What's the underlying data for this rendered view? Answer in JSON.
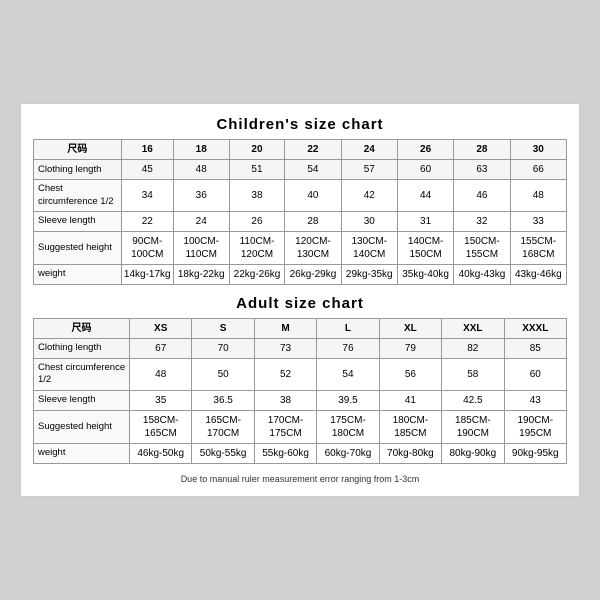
{
  "children_chart": {
    "title": "Children's size chart",
    "columns": [
      "尺码",
      "16",
      "18",
      "20",
      "22",
      "24",
      "26",
      "28",
      "30"
    ],
    "rows": [
      {
        "label": "Clothing length",
        "values": [
          "45",
          "48",
          "51",
          "54",
          "57",
          "60",
          "63",
          "66"
        ]
      },
      {
        "label": "Chest circumference 1/2",
        "values": [
          "34",
          "36",
          "38",
          "40",
          "42",
          "44",
          "46",
          "48"
        ]
      },
      {
        "label": "Sleeve length",
        "values": [
          "22",
          "24",
          "26",
          "28",
          "30",
          "31",
          "32",
          "33"
        ]
      },
      {
        "label": "Suggested height",
        "values": [
          "90CM-100CM",
          "100CM-110CM",
          "110CM-120CM",
          "120CM-130CM",
          "130CM-140CM",
          "140CM-150CM",
          "150CM-155CM",
          "155CM-168CM"
        ]
      },
      {
        "label": "weight",
        "values": [
          "14kg-17kg",
          "18kg-22kg",
          "22kg-26kg",
          "26kg-29kg",
          "29kg-35kg",
          "35kg-40kg",
          "40kg-43kg",
          "43kg-46kg"
        ]
      }
    ]
  },
  "adult_chart": {
    "title": "Adult size chart",
    "columns": [
      "尺码",
      "XS",
      "S",
      "M",
      "L",
      "XL",
      "XXL",
      "XXXL"
    ],
    "rows": [
      {
        "label": "Clothing length",
        "values": [
          "67",
          "70",
          "73",
          "76",
          "79",
          "82",
          "85"
        ]
      },
      {
        "label": "Chest circumference 1/2",
        "values": [
          "48",
          "50",
          "52",
          "54",
          "56",
          "58",
          "60"
        ]
      },
      {
        "label": "Sleeve length",
        "values": [
          "35",
          "36.5",
          "38",
          "39.5",
          "41",
          "42.5",
          "43"
        ]
      },
      {
        "label": "Suggested height",
        "values": [
          "158CM-165CM",
          "165CM-170CM",
          "170CM-175CM",
          "175CM-180CM",
          "180CM-185CM",
          "185CM-190CM",
          "190CM-195CM"
        ]
      },
      {
        "label": "weight",
        "values": [
          "46kg-50kg",
          "50kg-55kg",
          "55kg-60kg",
          "60kg-70kg",
          "70kg-80kg",
          "80kg-90kg",
          "90kg-95kg"
        ]
      }
    ]
  },
  "footer": "Due to manual ruler measurement error ranging from 1-3cm"
}
